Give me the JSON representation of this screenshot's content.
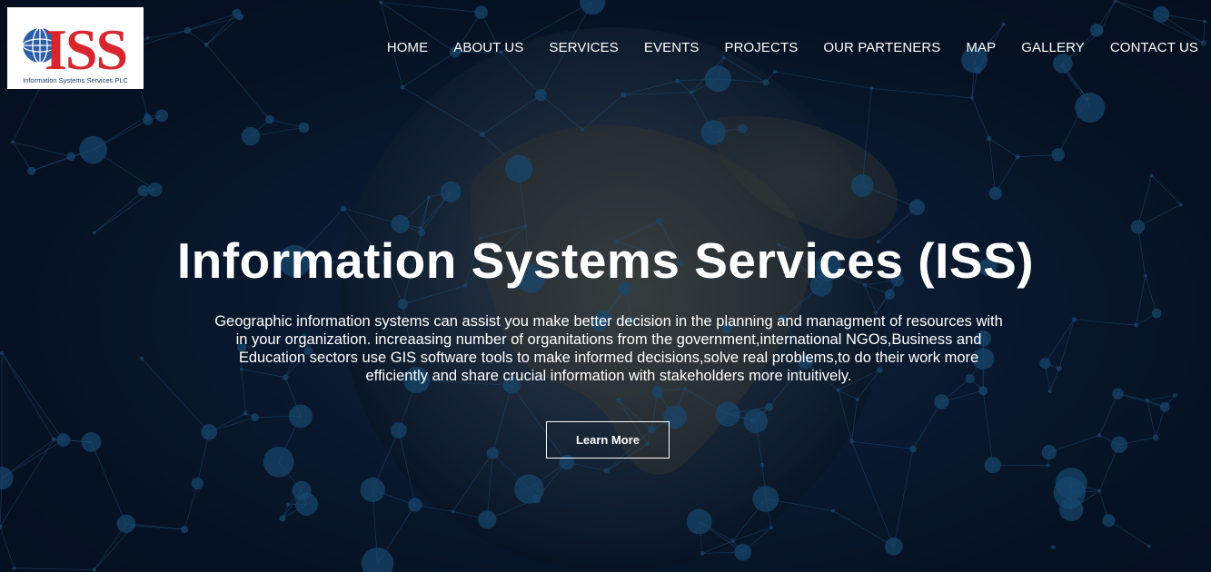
{
  "brand": {
    "logo_text": "ISS",
    "tagline": "Information Systems Services PLC"
  },
  "nav": {
    "items": [
      {
        "label": "HOME"
      },
      {
        "label": "ABOUT US"
      },
      {
        "label": "SERVICES"
      },
      {
        "label": "EVENTS"
      },
      {
        "label": "PROJECTS"
      },
      {
        "label": "OUR PARTENERS"
      },
      {
        "label": "MAP"
      },
      {
        "label": "GALLERY"
      },
      {
        "label": "CONTACT US"
      }
    ]
  },
  "hero": {
    "title": "Information Systems Services (ISS)",
    "description": "Geographic information systems can assist you make better decision in the planning and managment of resources with in your organization. increaasing number of organitations from the government,international NGOs,Business and Education sectors use GIS software tools to make informed decisions,solve real problems,to do their work more efficiently and share crucial information with stakeholders more intuitively.",
    "cta_label": "Learn More"
  },
  "colors": {
    "background": "#071528",
    "network_lines": "#2a6a9a",
    "network_nodes": "#1f5f8f",
    "logo_red": "#d7262e",
    "logo_blue": "#1e3a6e",
    "text": "#ffffff"
  }
}
